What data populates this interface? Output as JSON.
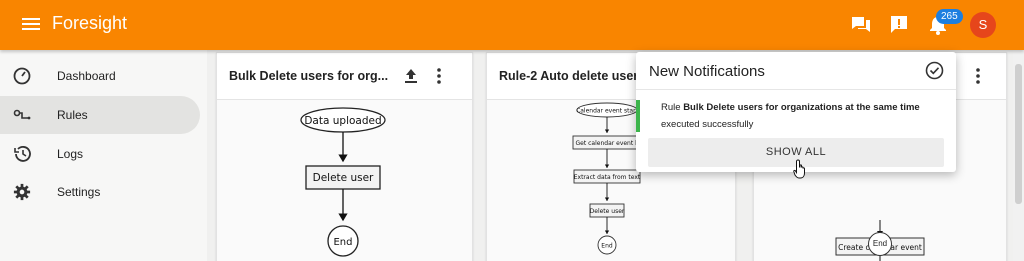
{
  "header": {
    "title": "Foresight",
    "notification_count": "265",
    "avatar_letter": "S",
    "icons": [
      "menu-icon",
      "chat-icon",
      "feedback-icon",
      "bell-icon"
    ]
  },
  "sidebar": {
    "items": [
      {
        "label": "Dashboard",
        "icon": "dashboard-icon",
        "active": false
      },
      {
        "label": "Rules",
        "icon": "rules-icon",
        "active": true
      },
      {
        "label": "Logs",
        "icon": "history-icon",
        "active": false
      },
      {
        "label": "Settings",
        "icon": "gear-icon",
        "active": false
      }
    ]
  },
  "cards": [
    {
      "title": "Bulk Delete users for org...",
      "flow": {
        "start": "Data uploaded",
        "steps": [
          "Delete user"
        ],
        "end": "End"
      }
    },
    {
      "title": "Rule-2 Auto delete user",
      "flow": {
        "start": "Calendar event start",
        "steps": [
          "Get calendar event li",
          "Extract data from text",
          "Delete user"
        ],
        "end": "End"
      }
    },
    {
      "title": "",
      "flow": {
        "steps": [
          "Create calendar event"
        ],
        "end": "End"
      }
    }
  ],
  "notifications": {
    "title": "New Notifications",
    "items": [
      {
        "prefix": "Rule ",
        "rule_name": "Bulk Delete users for organizations at the same time",
        "suffix": "executed successfully"
      }
    ],
    "show_all_label": "SHOW ALL"
  },
  "colors": {
    "header": "#f98500",
    "active_nav": "#e3e3e1",
    "badge": "#1e7fe0",
    "avatar": "#e6461b",
    "success_accent": "#3cb44b"
  }
}
